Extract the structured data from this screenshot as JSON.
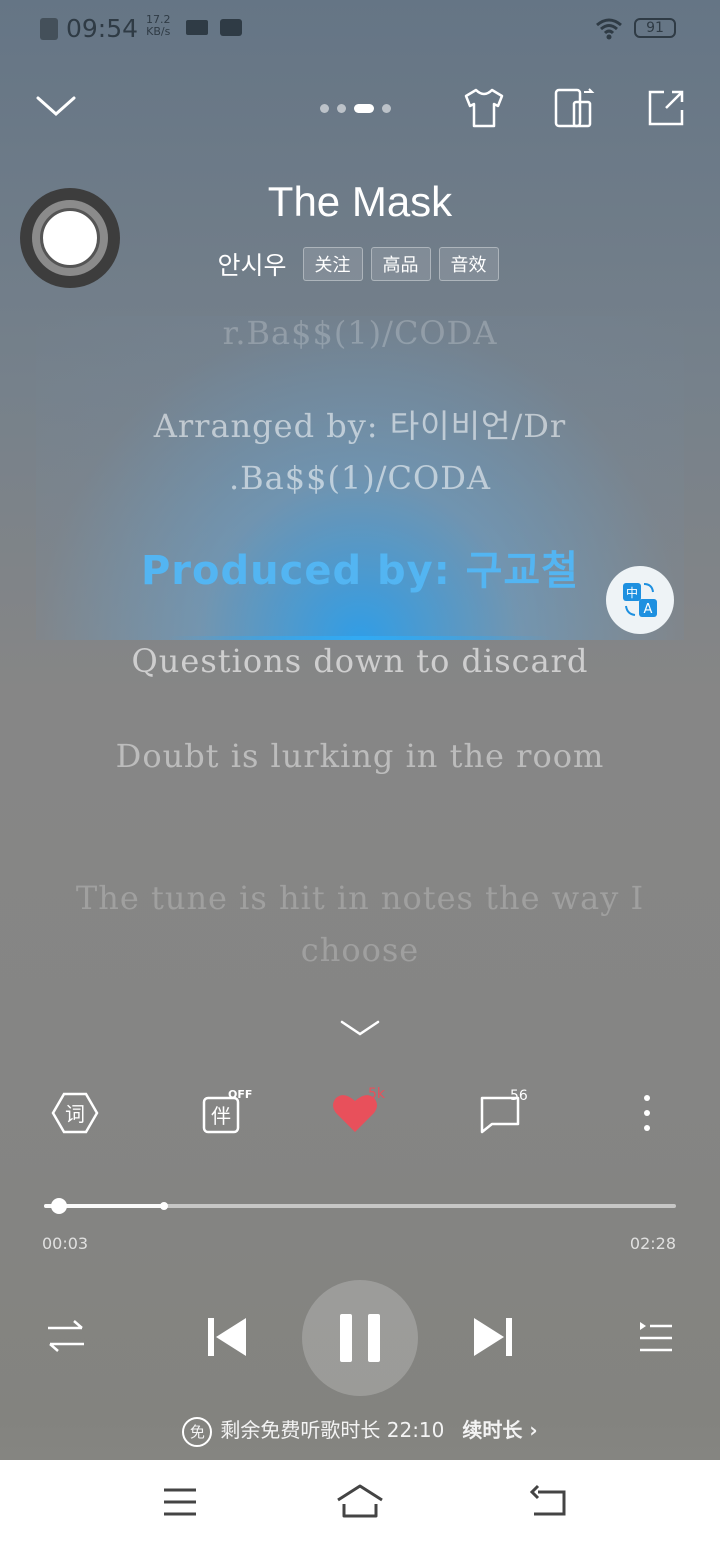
{
  "status_bar": {
    "time": "09:54",
    "net_speed_value": "17.2",
    "net_speed_unit": "KB/s",
    "battery": "91"
  },
  "header": {
    "song_title": "The Mask",
    "artist": "안시우",
    "tags": [
      "关注",
      "高品",
      "音效"
    ]
  },
  "lyrics": {
    "lines": [
      "r.Ba$$(1)/CODA",
      "Arranged by:  타이비언/Dr .Ba$$(1)/CODA",
      "Produced by:  구교철",
      "Questions down to discard",
      "Doubt is lurking in the room",
      "The tune is hit in notes the way I choose"
    ],
    "active_index": 2
  },
  "actions": {
    "accompany_state": "OFF",
    "like_count": "5k",
    "comment_count": "56"
  },
  "progress": {
    "current": "00:03",
    "total": "02:28",
    "played_fraction": 0.02,
    "buffered_fraction": 0.19
  },
  "trial": {
    "free_icon": "免",
    "remaining_text": "剩余免费听歌时长 22:10",
    "extend_label": "续时长",
    "extend_arrow": "›"
  },
  "colors": {
    "highlight_lyric": "#53b5f2",
    "like": "#e8505b"
  }
}
